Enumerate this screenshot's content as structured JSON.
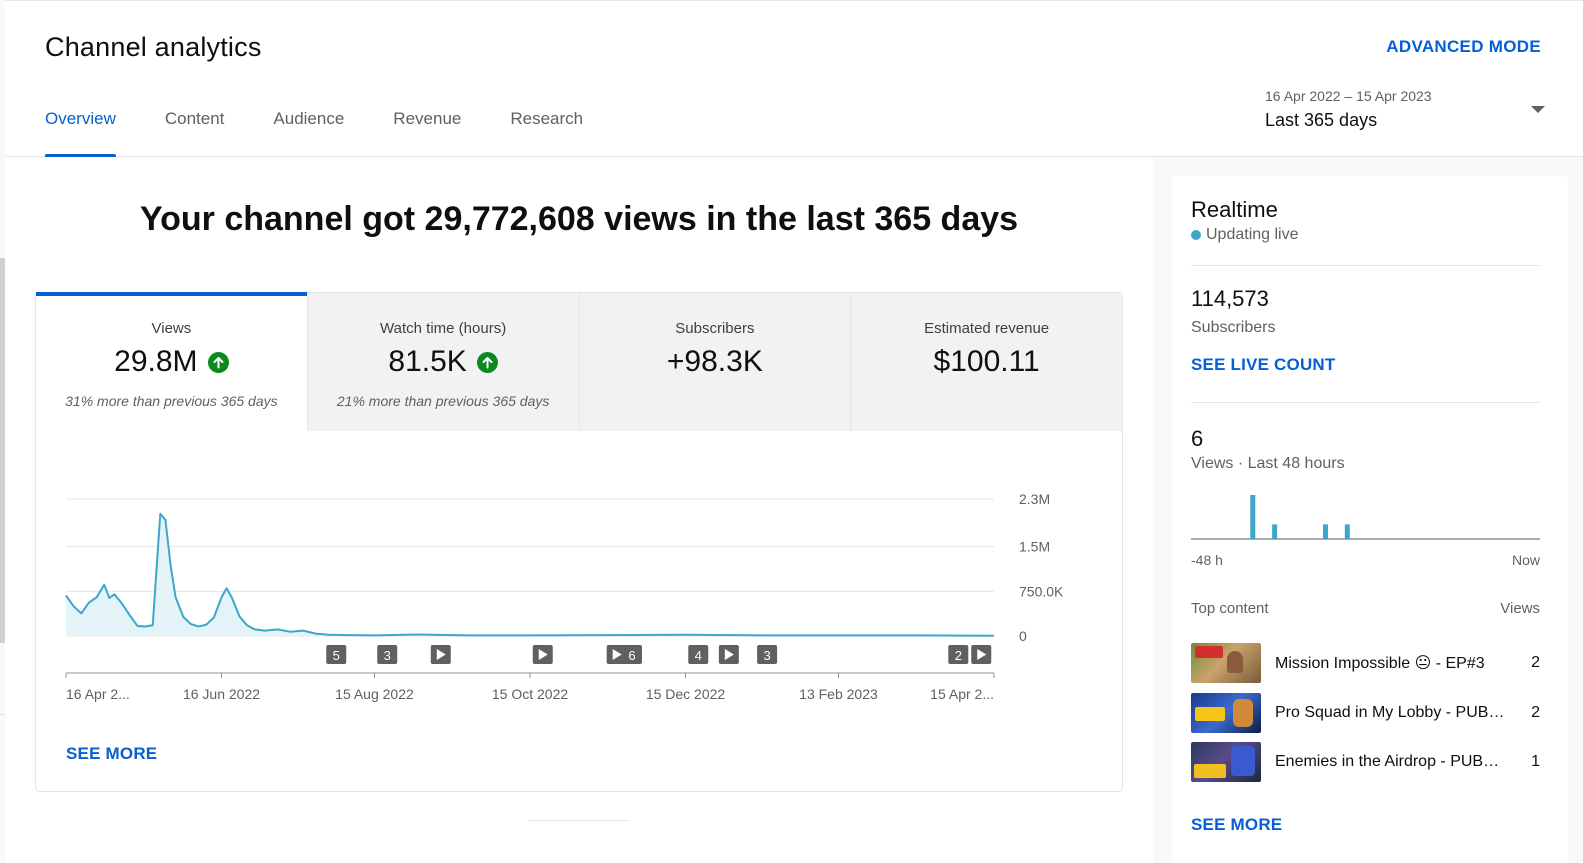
{
  "header": {
    "title": "Channel analytics",
    "advanced_mode": "ADVANCED MODE",
    "tabs": [
      {
        "label": "Overview",
        "active": true
      },
      {
        "label": "Content"
      },
      {
        "label": "Audience"
      },
      {
        "label": "Revenue"
      },
      {
        "label": "Research"
      }
    ],
    "date_range": {
      "dates": "16 Apr 2022 – 15 Apr 2023",
      "label": "Last 365 days"
    }
  },
  "main": {
    "headline": "Your channel got 29,772,608 views in the last 365 days",
    "metrics": [
      {
        "label": "Views",
        "value": "29.8M",
        "trend": "up",
        "note": "31% more than previous 365 days",
        "active": true
      },
      {
        "label": "Watch time (hours)",
        "value": "81.5K",
        "trend": "up",
        "note": "21% more than previous 365 days"
      },
      {
        "label": "Subscribers",
        "value": "+98.3K",
        "note": ""
      },
      {
        "label": "Estimated revenue",
        "value": "$100.11",
        "note": ""
      }
    ],
    "see_more": "SEE MORE",
    "chart_markers": [
      {
        "kind": "count",
        "label": "5",
        "date": "2022-07-31"
      },
      {
        "kind": "count",
        "label": "3",
        "date": "2022-08-20"
      },
      {
        "kind": "video",
        "label": "",
        "date": "2022-09-10"
      },
      {
        "kind": "video",
        "label": "",
        "date": "2022-10-20"
      },
      {
        "kind": "video",
        "label": "",
        "date": "2022-11-18"
      },
      {
        "kind": "count",
        "label": "6",
        "date": "2022-11-24"
      },
      {
        "kind": "count",
        "label": "4",
        "date": "2022-12-20"
      },
      {
        "kind": "video",
        "label": "",
        "date": "2023-01-01"
      },
      {
        "kind": "count",
        "label": "3",
        "date": "2023-01-16"
      },
      {
        "kind": "count",
        "label": "2",
        "date": "2023-04-01"
      },
      {
        "kind": "video",
        "label": "",
        "date": "2023-04-10"
      }
    ]
  },
  "chart_data": {
    "type": "area",
    "series": [
      {
        "x": [
          "2022-04-16",
          "2022-04-19",
          "2022-04-22",
          "2022-04-25",
          "2022-04-28",
          "2022-05-01",
          "2022-05-03",
          "2022-05-05",
          "2022-05-08",
          "2022-05-11",
          "2022-05-14",
          "2022-05-17",
          "2022-05-20",
          "2022-05-23",
          "2022-05-25",
          "2022-05-27",
          "2022-05-29",
          "2022-06-01",
          "2022-06-04",
          "2022-06-07",
          "2022-06-10",
          "2022-06-13",
          "2022-06-16",
          "2022-06-18",
          "2022-06-20",
          "2022-06-23",
          "2022-06-26",
          "2022-06-29",
          "2022-07-03",
          "2022-07-08",
          "2022-07-13",
          "2022-07-18",
          "2022-07-23",
          "2022-07-28",
          "2022-08-05",
          "2022-08-15",
          "2022-09-01",
          "2022-09-20",
          "2022-10-15",
          "2022-11-15",
          "2022-12-15",
          "2023-01-15",
          "2023-02-15",
          "2023-03-15",
          "2023-04-15"
        ],
        "y": [
          680000,
          500000,
          380000,
          560000,
          650000,
          860000,
          640000,
          700000,
          540000,
          350000,
          170000,
          160000,
          180000,
          2050000,
          1950000,
          1200000,
          650000,
          320000,
          200000,
          160000,
          190000,
          310000,
          650000,
          800000,
          650000,
          330000,
          180000,
          110000,
          90000,
          110000,
          70000,
          90000,
          40000,
          20000,
          15000,
          10000,
          25000,
          10000,
          10000,
          15000,
          20000,
          10000,
          10000,
          10000,
          5000
        ]
      }
    ],
    "ylim": [
      0,
      2300000
    ],
    "y_ticks": [
      "2.3M",
      "1.5M",
      "750.0K",
      "0"
    ],
    "x_ticks": [
      "16 Apr 2...",
      "16 Jun 2022",
      "15 Aug 2022",
      "15 Oct 2022",
      "15 Dec 2022",
      "13 Feb 2023",
      "15 Apr 2..."
    ],
    "xlim": [
      "2022-04-16",
      "2023-04-15"
    ],
    "grid": true,
    "color": "#3ea6ca"
  },
  "realtime": {
    "title": "Realtime",
    "status": "Updating live",
    "subscribers_value": "114,573",
    "subscribers_label": "Subscribers",
    "live_count": "SEE LIVE COUNT",
    "views_value": "6",
    "views_label": "Views · Last 48 hours",
    "hourly_views": [
      0,
      0,
      0,
      0,
      0,
      0,
      0,
      0,
      0,
      0,
      0,
      0,
      0,
      0,
      0,
      0,
      0,
      0,
      0,
      0,
      0,
      0,
      0,
      0,
      0,
      0,
      0,
      0,
      0,
      0,
      0,
      0,
      0,
      0,
      0,
      0,
      0,
      0,
      0,
      0,
      0,
      0,
      0,
      0,
      0,
      0,
      0,
      0,
      0,
      0,
      0,
      0,
      0,
      0,
      0,
      0,
      0,
      0,
      0,
      0,
      0,
      0,
      0,
      0,
      0,
      0,
      0,
      0,
      0,
      0
    ],
    "bars": [
      {
        "hours_ago": 39.5,
        "views": 3
      },
      {
        "hours_ago": 36.5,
        "views": 1
      },
      {
        "hours_ago": 29.5,
        "views": 1
      },
      {
        "hours_ago": 26.5,
        "views": 1
      }
    ],
    "axis_left": "-48 h",
    "axis_right": "Now",
    "top_content_label": "Top content",
    "top_content_views_label": "Views",
    "top_content": [
      {
        "title": "Mission Impossible 😐 - EP#3",
        "views": "2"
      },
      {
        "title": "Pro Squad in My Lobby - PUBG Mobile",
        "views": "2"
      },
      {
        "title": "Enemies in the Airdrop - PUBG Mobile",
        "views": "1"
      }
    ],
    "see_more": "SEE MORE"
  },
  "colors": {
    "accent": "#065fd4",
    "chart": "#3ea6ca",
    "up": "#0a8a1f"
  }
}
